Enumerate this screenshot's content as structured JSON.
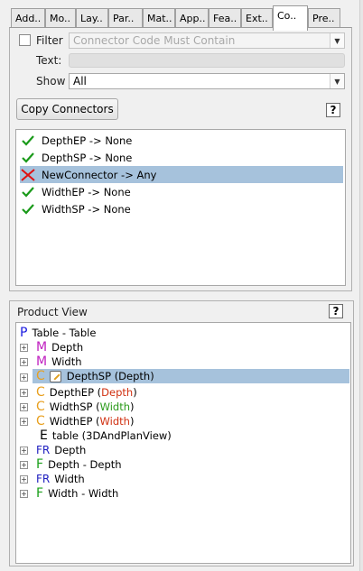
{
  "tabs": [
    {
      "label": "Add..",
      "active": false
    },
    {
      "label": "Mo..",
      "active": false
    },
    {
      "label": "Lay..",
      "active": false
    },
    {
      "label": "Par..",
      "active": false
    },
    {
      "label": "Mat..",
      "active": false
    },
    {
      "label": "App..",
      "active": false
    },
    {
      "label": "Fea..",
      "active": false
    },
    {
      "label": "Ext..",
      "active": false
    },
    {
      "label": "Co..",
      "active": true
    },
    {
      "label": "Pre..",
      "active": false
    }
  ],
  "filter": {
    "label": "Filter",
    "checked": false,
    "placeholder": "Connector Code Must Contain",
    "text_label": "Text:",
    "text_value": "",
    "show_label": "Show",
    "show_value": "All"
  },
  "copy_button": "Copy Connectors",
  "help": "?",
  "connectors": [
    {
      "label": "DepthEP -> None",
      "status": "check"
    },
    {
      "label": "DepthSP -> None",
      "status": "check"
    },
    {
      "label": "NewConnector -> Any",
      "status": "cross",
      "selected": true
    },
    {
      "label": "WidthEP -> None",
      "status": "check"
    },
    {
      "label": "WidthSP -> None",
      "status": "check"
    }
  ],
  "product_view": {
    "title": "Product View",
    "colors": {
      "P": "#1a1ae0",
      "M": "#c020c0",
      "C": "#e8a020",
      "E": "#000000",
      "FR": "#2020c0",
      "F": "#1aa01a",
      "param_red": "#d03010",
      "param_green": "#2a9a1a"
    },
    "nodes": [
      {
        "letter": "P",
        "text": "Table - Table",
        "expander": false
      },
      {
        "letter": "M",
        "text": "Depth",
        "expander": true
      },
      {
        "letter": "M",
        "text": "Width",
        "expander": true
      },
      {
        "letter": "C",
        "text": "DepthSP (Depth)",
        "expander": true,
        "selected": true,
        "pencil": true
      },
      {
        "letter": "C",
        "text": "DepthEP (",
        "param": "Depth",
        "param_color": "red",
        "suffix": ")",
        "expander": true
      },
      {
        "letter": "C",
        "text": "WidthSP (",
        "param": "Width",
        "param_color": "green",
        "suffix": ")",
        "expander": true
      },
      {
        "letter": "C",
        "text": "WidthEP (",
        "param": "Width",
        "param_color": "red",
        "suffix": ")",
        "expander": true
      },
      {
        "letter": "E",
        "text": "table (3DAndPlanView)",
        "expander": false
      },
      {
        "letter": "FR",
        "text": "Depth",
        "expander": true
      },
      {
        "letter": "F",
        "text": "Depth - Depth",
        "expander": true
      },
      {
        "letter": "FR",
        "text": "Width",
        "expander": true
      },
      {
        "letter": "F",
        "text": "Width - Width",
        "expander": true
      }
    ]
  }
}
